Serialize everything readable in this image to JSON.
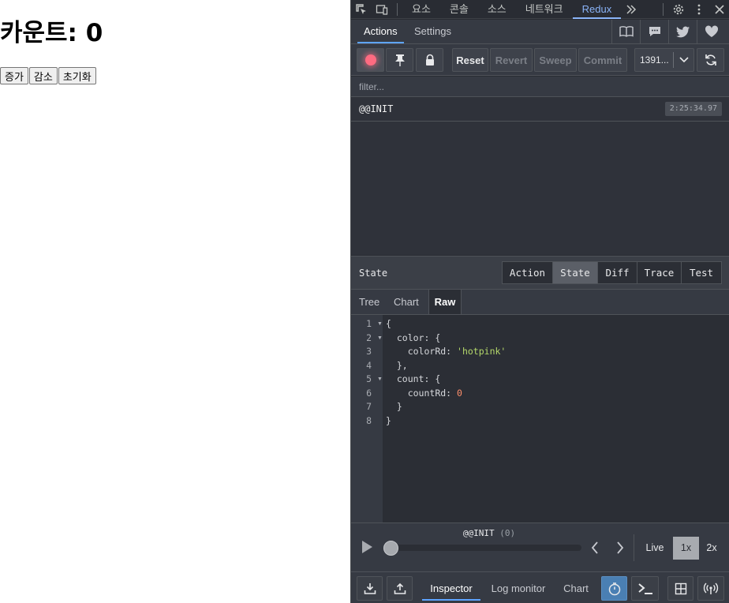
{
  "app": {
    "heading": "카운트: 0",
    "buttons": {
      "increase": "증가",
      "decrease": "감소",
      "reset": "초기화"
    }
  },
  "devtools": {
    "top_tabs": [
      "요소",
      "콘솔",
      "소스",
      "네트워크",
      "Redux"
    ],
    "active_top_tab": "Redux",
    "redux": {
      "tabs": {
        "actions": "Actions",
        "settings": "Settings"
      },
      "toolbar": {
        "reset": "Reset",
        "revert": "Revert",
        "sweep": "Sweep",
        "commit": "Commit",
        "instance": "1391..."
      },
      "filter_placeholder": "filter...",
      "actions": [
        {
          "name": "@@INIT",
          "time": "2:25:34.97"
        }
      ],
      "state_panel": {
        "label": "State",
        "view_buttons": [
          "Action",
          "State",
          "Diff",
          "Trace",
          "Test"
        ],
        "active_view": "State",
        "sub_tabs": [
          "Tree",
          "Chart",
          "Raw"
        ],
        "active_sub_tab": "Raw",
        "raw": {
          "line_numbers": [
            "1",
            "2",
            "3",
            "4",
            "5",
            "6",
            "7",
            "8"
          ],
          "open_brace": "{",
          "color_key": "color",
          "color_rd_key": "colorRd",
          "color_rd_value": "'hotpink'",
          "count_key": "count",
          "count_rd_key": "countRd",
          "count_rd_value": "0",
          "close_brace": "}"
        }
      },
      "slider": {
        "action_label": "@@INIT",
        "action_index": "(0)",
        "position": 0,
        "live": "Live",
        "speed_1x": "1x",
        "speed_2x": "2x",
        "active_speed": "1x"
      },
      "bottom_tabs": [
        "Inspector",
        "Log monitor",
        "Chart"
      ],
      "active_bottom_tab": "Inspector"
    }
  },
  "colors": {
    "accent": "#5ea4ff",
    "record": "#ff6b81",
    "string": "#b5d96b",
    "number": "#ff8f6b",
    "chrome_active": "#8ab4f8"
  }
}
